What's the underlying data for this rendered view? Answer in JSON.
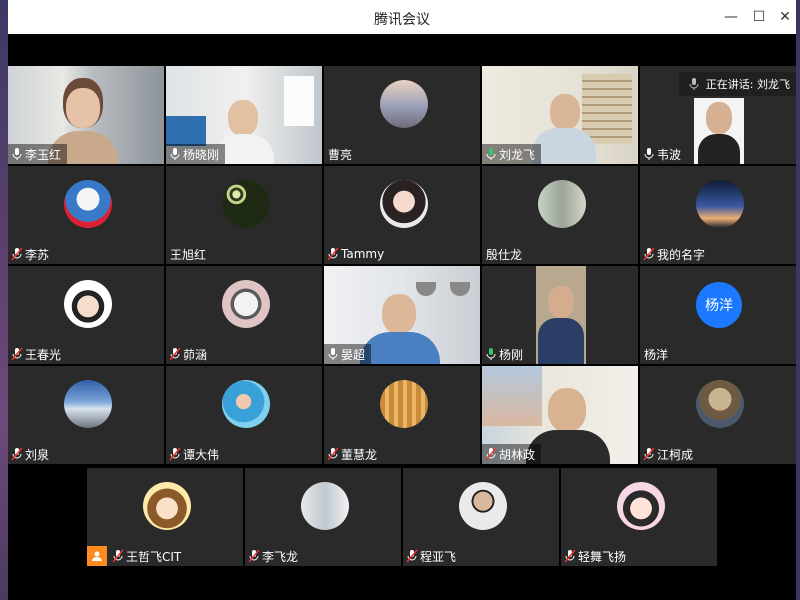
{
  "window": {
    "title": "腾讯会议"
  },
  "speaking": {
    "label": "正在讲话: 刘龙飞"
  },
  "tiles": [
    {
      "name": "李玉红"
    },
    {
      "name": "杨晓刚"
    },
    {
      "name": "曹亮"
    },
    {
      "name": "刘龙飞"
    },
    {
      "name": "韦波"
    },
    {
      "name": "李苏"
    },
    {
      "name": "王旭红"
    },
    {
      "name": "Tammy"
    },
    {
      "name": "殷仕龙"
    },
    {
      "name": "我的名字"
    },
    {
      "name": "王春光"
    },
    {
      "name": "茆涵"
    },
    {
      "name": "晏超"
    },
    {
      "name": "杨刚"
    },
    {
      "name": "杨洋",
      "avatar_text": "杨洋"
    },
    {
      "name": "刘泉"
    },
    {
      "name": "谭大伟"
    },
    {
      "name": "董慧龙"
    },
    {
      "name": "胡林政"
    },
    {
      "name": "江柯成"
    },
    {
      "name": "王哲飞CIT"
    },
    {
      "name": "李飞龙"
    },
    {
      "name": "程亚飞"
    },
    {
      "name": "轻舞飞扬"
    }
  ],
  "colors": {
    "active_border": "#35c56a",
    "tile_bg": "#2a2a2a",
    "avatar_blue": "#1a79ff",
    "host_badge": "#ff8a1f"
  }
}
